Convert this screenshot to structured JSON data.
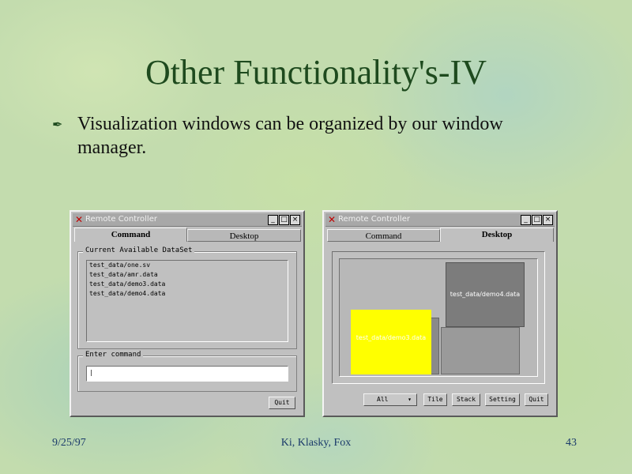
{
  "slide": {
    "title": "Other Functionality's-IV",
    "bullet_icon": "pen-bullet-icon",
    "bullet_text": "Visualization windows can be organized by our window manager.",
    "footer": {
      "date": "9/25/97",
      "authors": "Ki, Klasky, Fox",
      "page": "43"
    }
  },
  "left_window": {
    "title": "Remote Controller",
    "buttons": {
      "minimize": "_",
      "maximize": "□",
      "close": "×"
    },
    "tabs": [
      {
        "label": "Command",
        "active": true
      },
      {
        "label": "Desktop",
        "active": false
      }
    ],
    "dataset_group_label": "Current Available DataSet",
    "datasets": [
      "test_data/one.sv",
      "test_data/amr.data",
      "test_data/demo3.data",
      "test_data/demo4.data"
    ],
    "command_group_label": "Enter command",
    "command_value": "|",
    "quit_label": "Quit"
  },
  "right_window": {
    "title": "Remote Controller",
    "buttons": {
      "minimize": "_",
      "maximize": "□",
      "close": "×"
    },
    "tabs": [
      {
        "label": "Command",
        "active": false
      },
      {
        "label": "Desktop",
        "active": true
      }
    ],
    "desktop_windows": [
      {
        "label": "test_data/demo4.data",
        "color": "#7c7c7c"
      },
      {
        "label": "test_data/demo3.data",
        "color": "#ffff00"
      }
    ],
    "layout_select": "All",
    "layout_select_arrow": "▾",
    "toolbar": {
      "tile": "Tile",
      "stack": "Stack",
      "setting": "Setting",
      "quit": "Quit"
    }
  },
  "colors": {
    "title": "#1e4a1e",
    "footer": "#1a3a6a",
    "highlight": "#ffff00"
  }
}
